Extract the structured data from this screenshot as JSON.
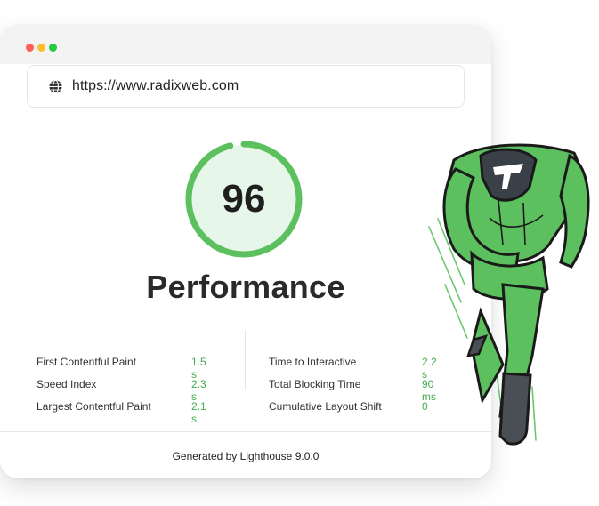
{
  "browser": {
    "url": "https://www.radixweb.com",
    "icon": "globe-icon"
  },
  "report": {
    "score": "96",
    "score_value": 96,
    "title": "Performance",
    "accent_color": "#5cc05f",
    "metrics_left": [
      {
        "label": "First Contentful Paint",
        "value": "1.5 s"
      },
      {
        "label": "Speed Index",
        "value": "2.3 s"
      },
      {
        "label": "Largest Contentful Paint",
        "value": "2.1 s"
      }
    ],
    "metrics_right": [
      {
        "label": "Time to Interactive",
        "value": "2.2 s"
      },
      {
        "label": "Total Blocking Time",
        "value": "90 ms"
      },
      {
        "label": "Cumulative Layout Shift",
        "value": "0"
      }
    ],
    "footer": "Generated by Lighthouse 9.0.0"
  },
  "illustration": {
    "name": "mascot-runner",
    "colors": {
      "suit": "#5cc05f",
      "outline": "#1a1a1a",
      "boots": "#4a4f55"
    }
  }
}
